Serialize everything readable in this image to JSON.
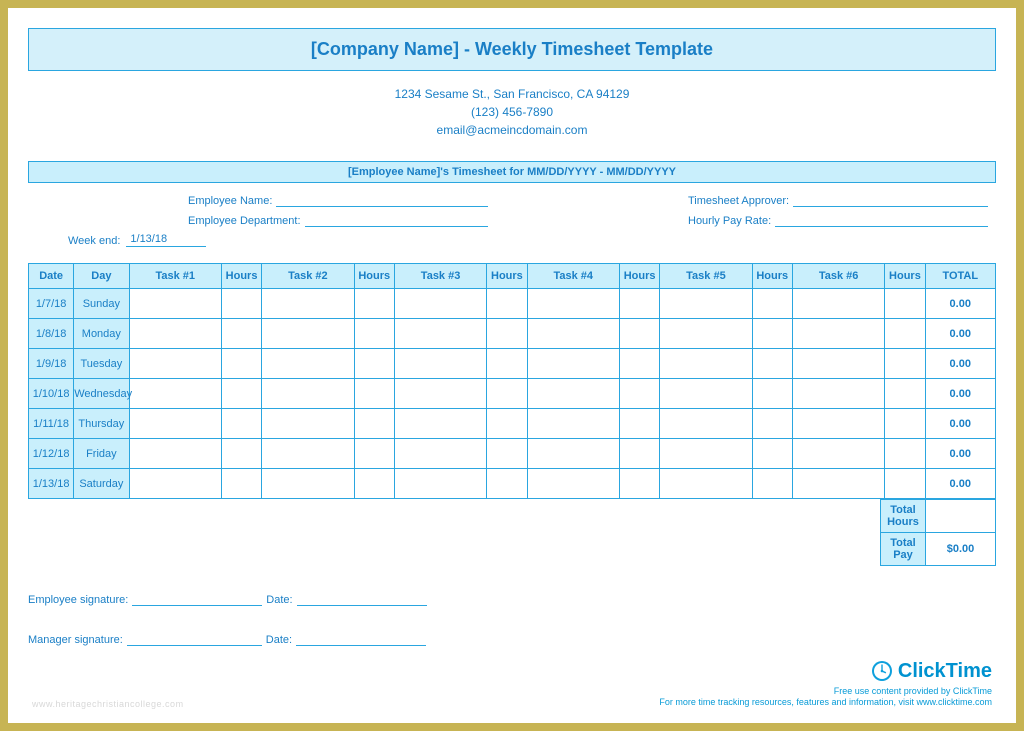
{
  "title": "[Company Name] - Weekly Timesheet Template",
  "company": {
    "address": "1234 Sesame St.,  San Francisco, CA 94129",
    "phone": "(123) 456-7890",
    "email": "email@acmeincdomain.com"
  },
  "subheader": "[Employee Name]'s Timesheet for MM/DD/YYYY - MM/DD/YYYY",
  "meta": {
    "employee_name_label": "Employee Name:",
    "employee_dept_label": "Employee Department:",
    "approver_label": "Timesheet Approver:",
    "rate_label": "Hourly Pay Rate:",
    "week_end_label": "Week end:",
    "week_end_value": "1/13/18"
  },
  "columns": {
    "date": "Date",
    "day": "Day",
    "task1": "Task #1",
    "task2": "Task #2",
    "task3": "Task #3",
    "task4": "Task #4",
    "task5": "Task #5",
    "task6": "Task #6",
    "hours": "Hours",
    "total": "TOTAL"
  },
  "rows": [
    {
      "date": "1/7/18",
      "day": "Sunday",
      "total": "0.00"
    },
    {
      "date": "1/8/18",
      "day": "Monday",
      "total": "0.00"
    },
    {
      "date": "1/9/18",
      "day": "Tuesday",
      "total": "0.00"
    },
    {
      "date": "1/10/18",
      "day": "Wednesday",
      "total": "0.00"
    },
    {
      "date": "1/11/18",
      "day": "Thursday",
      "total": "0.00"
    },
    {
      "date": "1/12/18",
      "day": "Friday",
      "total": "0.00"
    },
    {
      "date": "1/13/18",
      "day": "Saturday",
      "total": "0.00"
    }
  ],
  "summary": {
    "total_hours_label": "Total Hours",
    "total_hours_value": "",
    "total_pay_label": "Total Pay",
    "total_pay_value": "$0.00"
  },
  "signatures": {
    "employee_label": "Employee signature:",
    "manager_label": "Manager signature:",
    "date_label": "Date:"
  },
  "footer": {
    "brand": "ClickTime",
    "line1": "Free use content provided by ClickTime",
    "line2": "For more time tracking resources, features and information, visit www.clicktime.com"
  },
  "faint": "www.heritagechristiancollege.com"
}
